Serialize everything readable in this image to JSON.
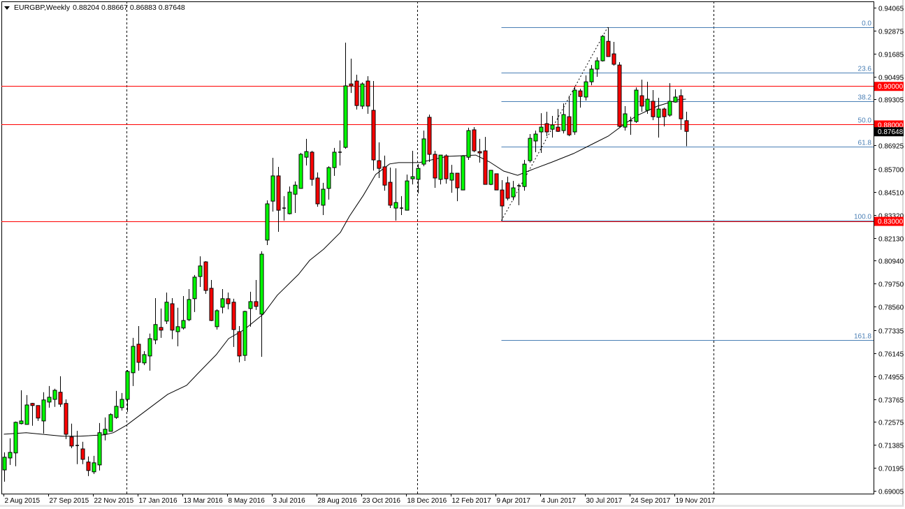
{
  "header": {
    "menu_icon": "triangle-down-icon",
    "symbol_timeframe": "EURGBP,Weekly",
    "ohlc": "0.88204 0.88667 0.86883 0.87648"
  },
  "colors": {
    "up": "#00ff00",
    "down": "#ff0000",
    "ma": "#000000",
    "fib": "#4a7fb5",
    "hline": "#ff0000",
    "current_price_bg": "#000000"
  },
  "chart_data": {
    "type": "candlestick",
    "title": "EURGBP,Weekly",
    "xlabel": "",
    "ylabel": "",
    "ylim": [
      0.6886,
      0.94463
    ],
    "grid": false,
    "y_tick_labels": [
      "0.94065",
      "0.92875",
      "0.91685",
      "0.90495",
      "0.89305",
      "0.86925",
      "0.85700",
      "0.84510",
      "0.83320",
      "0.82130",
      "0.80940",
      "0.79750",
      "0.78560",
      "0.77335",
      "0.76145",
      "0.74955",
      "0.73765",
      "0.72575",
      "0.71385",
      "0.70195",
      "0.69005"
    ],
    "x_tick_labels": [
      "2 Aug 2015",
      "27 Sep 2015",
      "22 Nov 2015",
      "17 Jan 2016",
      "13 Mar 2016",
      "8 May 2016",
      "3 Jul 2016",
      "28 Aug 2016",
      "23 Oct 2016",
      "18 Dec 2016",
      "12 Feb 2017",
      "9 Apr 2017",
      "4 Jun 2017",
      "30 Jul 2017",
      "24 Sep 2017",
      "19 Nov 2017"
    ],
    "x_tick_every_candles": 8,
    "period_separators_at_candle": [
      22,
      74,
      127
    ],
    "candles_ohlc": [
      [
        0.7009,
        0.71,
        0.6948,
        0.7075
      ],
      [
        0.7071,
        0.7173,
        0.7035,
        0.71
      ],
      [
        0.7097,
        0.726,
        0.7028,
        0.7256
      ],
      [
        0.7249,
        0.7422,
        0.7245,
        0.7263
      ],
      [
        0.7245,
        0.7397,
        0.7245,
        0.7346
      ],
      [
        0.7354,
        0.7357,
        0.7238,
        0.7343
      ],
      [
        0.7343,
        0.7343,
        0.7263,
        0.7278
      ],
      [
        0.7263,
        0.7412,
        0.7198,
        0.7372
      ],
      [
        0.7361,
        0.7444,
        0.7332,
        0.7386
      ],
      [
        0.7375,
        0.743,
        0.7336,
        0.7422
      ],
      [
        0.7412,
        0.7495,
        0.7336,
        0.735
      ],
      [
        0.7354,
        0.7375,
        0.7169,
        0.7194
      ],
      [
        0.718,
        0.7249,
        0.7122,
        0.7133
      ],
      [
        0.7136,
        0.7212,
        0.7039,
        0.7133
      ],
      [
        0.7118,
        0.7155,
        0.7039,
        0.7064
      ],
      [
        0.705,
        0.7079,
        0.6977,
        0.7006
      ],
      [
        0.6999,
        0.7082,
        0.6988,
        0.7046
      ],
      [
        0.7035,
        0.7252,
        0.7006,
        0.7202
      ],
      [
        0.7194,
        0.7281,
        0.7162,
        0.722
      ],
      [
        0.7209,
        0.7303,
        0.7209,
        0.7296
      ],
      [
        0.7281,
        0.7419,
        0.7274,
        0.7339
      ],
      [
        0.7332,
        0.7408,
        0.7317,
        0.7375
      ],
      [
        0.7375,
        0.7527,
        0.731,
        0.752
      ],
      [
        0.7513,
        0.7694,
        0.7444,
        0.765
      ],
      [
        0.7661,
        0.7755,
        0.7524,
        0.7567
      ],
      [
        0.7564,
        0.7625,
        0.7553,
        0.7607
      ],
      [
        0.76,
        0.7716,
        0.7524,
        0.769
      ],
      [
        0.7683,
        0.79,
        0.7661,
        0.7763
      ],
      [
        0.7748,
        0.7846,
        0.7694,
        0.7734
      ],
      [
        0.7781,
        0.7929,
        0.7766,
        0.7879
      ],
      [
        0.7871,
        0.79,
        0.7687,
        0.7734
      ],
      [
        0.7726,
        0.785,
        0.765,
        0.7752
      ],
      [
        0.7745,
        0.7911,
        0.7737,
        0.7784
      ],
      [
        0.7788,
        0.7947,
        0.7781,
        0.7893
      ],
      [
        0.7897,
        0.802,
        0.7828,
        0.8009
      ],
      [
        0.8012,
        0.8117,
        0.7958,
        0.8067
      ],
      [
        0.8088,
        0.8092,
        0.7922,
        0.794
      ],
      [
        0.7951,
        0.7994,
        0.7781,
        0.7784
      ],
      [
        0.7752,
        0.7842,
        0.7737,
        0.7835
      ],
      [
        0.7853,
        0.7947,
        0.7821,
        0.7897
      ],
      [
        0.7897,
        0.7929,
        0.7842,
        0.7871
      ],
      [
        0.7879,
        0.7897,
        0.7647,
        0.7737
      ],
      [
        0.7726,
        0.7755,
        0.7567,
        0.76
      ],
      [
        0.7603,
        0.7835,
        0.7574,
        0.7831
      ],
      [
        0.7846,
        0.7933,
        0.7752,
        0.7882
      ],
      [
        0.7882,
        0.7994,
        0.7839,
        0.7857
      ],
      [
        0.7817,
        0.8143,
        0.7596,
        0.8128
      ],
      [
        0.8201,
        0.8407,
        0.8175,
        0.8389
      ],
      [
        0.8403,
        0.8628,
        0.8349,
        0.8534
      ],
      [
        0.8534,
        0.8581,
        0.8244,
        0.8356
      ],
      [
        0.8367,
        0.8429,
        0.8302,
        0.8367
      ],
      [
        0.8338,
        0.8479,
        0.8334,
        0.845
      ],
      [
        0.8439,
        0.8505,
        0.8342,
        0.8486
      ],
      [
        0.8469,
        0.8653,
        0.8469,
        0.8646
      ],
      [
        0.8631,
        0.8726,
        0.8588,
        0.866
      ],
      [
        0.8657,
        0.8664,
        0.8483,
        0.8516
      ],
      [
        0.8523,
        0.8552,
        0.8374,
        0.8389
      ],
      [
        0.8382,
        0.8498,
        0.8331,
        0.8465
      ],
      [
        0.8469,
        0.8584,
        0.8411,
        0.8577
      ],
      [
        0.8577,
        0.8679,
        0.8534,
        0.8657
      ],
      [
        0.8657,
        0.8718,
        0.8588,
        0.8657
      ],
      [
        0.8682,
        0.9225,
        0.8675,
        0.9001
      ],
      [
        0.9011,
        0.9142,
        0.8964,
        0.9001
      ],
      [
        0.9026,
        0.9059,
        0.8878,
        0.8899
      ],
      [
        0.8896,
        0.9019,
        0.8881,
        0.9011
      ],
      [
        0.9026,
        0.9051,
        0.8856,
        0.8896
      ],
      [
        0.8874,
        0.9026,
        0.8562,
        0.8617
      ],
      [
        0.8613,
        0.8708,
        0.8523,
        0.8573
      ],
      [
        0.8581,
        0.8639,
        0.8457,
        0.8486
      ],
      [
        0.8501,
        0.8577,
        0.8367,
        0.8382
      ],
      [
        0.8367,
        0.8573,
        0.8302,
        0.8396
      ],
      [
        0.8367,
        0.8429,
        0.8331,
        0.8367
      ],
      [
        0.8356,
        0.8541,
        0.8356,
        0.8508
      ],
      [
        0.8519,
        0.8664,
        0.849,
        0.853
      ],
      [
        0.8516,
        0.8595,
        0.8443,
        0.8573
      ],
      [
        0.8595,
        0.8769,
        0.8584,
        0.8726
      ],
      [
        0.8838,
        0.8852,
        0.8606,
        0.8646
      ],
      [
        0.8646,
        0.8664,
        0.8472,
        0.8523
      ],
      [
        0.8516,
        0.8642,
        0.849,
        0.8642
      ],
      [
        0.8638,
        0.8646,
        0.8494,
        0.8519
      ],
      [
        0.8512,
        0.8591,
        0.8447,
        0.8548
      ],
      [
        0.8548,
        0.8548,
        0.8403,
        0.8472
      ],
      [
        0.8461,
        0.8642,
        0.8461,
        0.8638
      ],
      [
        0.8631,
        0.8784,
        0.8617,
        0.8769
      ],
      [
        0.8773,
        0.8787,
        0.8657,
        0.8664
      ],
      [
        0.866,
        0.8726,
        0.8603,
        0.8653
      ],
      [
        0.8664,
        0.8736,
        0.849,
        0.849
      ],
      [
        0.849,
        0.8563,
        0.8486,
        0.8563
      ],
      [
        0.8545,
        0.8545,
        0.8461,
        0.8461
      ],
      [
        0.8461,
        0.8512,
        0.8302,
        0.8378
      ],
      [
        0.8498,
        0.853,
        0.8407,
        0.8418
      ],
      [
        0.8425,
        0.8508,
        0.8407,
        0.8472
      ],
      [
        0.8483,
        0.8494,
        0.8382,
        0.8483
      ],
      [
        0.8479,
        0.8617,
        0.8457,
        0.8595
      ],
      [
        0.8613,
        0.8751,
        0.8603,
        0.8729
      ],
      [
        0.8715,
        0.8769,
        0.8657,
        0.8751
      ],
      [
        0.8762,
        0.8859,
        0.8653,
        0.8787
      ],
      [
        0.8805,
        0.8867,
        0.874,
        0.8762
      ],
      [
        0.8776,
        0.8845,
        0.8733,
        0.8798
      ],
      [
        0.8787,
        0.8881,
        0.8762,
        0.8765
      ],
      [
        0.8769,
        0.891,
        0.8754,
        0.8852
      ],
      [
        0.8841,
        0.895,
        0.874,
        0.8747
      ],
      [
        0.8762,
        0.8997,
        0.8747,
        0.8979
      ],
      [
        0.8975,
        0.8986,
        0.8888,
        0.8946
      ],
      [
        0.8943,
        0.9055,
        0.8925,
        0.9022
      ],
      [
        0.9022,
        0.9109,
        0.9004,
        0.9088
      ],
      [
        0.9088,
        0.9149,
        0.9048,
        0.9131
      ],
      [
        0.9131,
        0.9265,
        0.9127,
        0.9258
      ],
      [
        0.9232,
        0.9305,
        0.9153,
        0.9153
      ],
      [
        0.9167,
        0.9229,
        0.9106,
        0.9113
      ],
      [
        0.9109,
        0.9124,
        0.8787,
        0.8791
      ],
      [
        0.8787,
        0.8896,
        0.8769,
        0.8856
      ],
      [
        0.882,
        0.8841,
        0.8747,
        0.882
      ],
      [
        0.8816,
        0.8993,
        0.8809,
        0.8979
      ],
      [
        0.895,
        0.9033,
        0.8867,
        0.8896
      ],
      [
        0.8874,
        0.9022,
        0.8856,
        0.8932
      ],
      [
        0.8921,
        0.8979,
        0.8823,
        0.8841
      ],
      [
        0.8838,
        0.8939,
        0.8733,
        0.8881
      ],
      [
        0.8881,
        0.8888,
        0.8791,
        0.8841
      ],
      [
        0.8849,
        0.9015,
        0.8841,
        0.8921
      ],
      [
        0.8917,
        0.8983,
        0.8914,
        0.8943
      ],
      [
        0.895,
        0.8983,
        0.8773,
        0.883
      ],
      [
        0.88204,
        0.88667,
        0.86883,
        0.87648
      ]
    ],
    "moving_average": [
      [
        0,
        0.7194
      ],
      [
        4,
        0.7202
      ],
      [
        10.5,
        0.7184
      ],
      [
        13.6,
        0.7184
      ],
      [
        18,
        0.7191
      ],
      [
        19.6,
        0.7202
      ],
      [
        22,
        0.7242
      ],
      [
        25.5,
        0.7318
      ],
      [
        29.3,
        0.7401
      ],
      [
        32.7,
        0.7448
      ],
      [
        34.7,
        0.7509
      ],
      [
        38,
        0.7607
      ],
      [
        40.2,
        0.769
      ],
      [
        43,
        0.7737
      ],
      [
        46.4,
        0.7817
      ],
      [
        48.9,
        0.7915
      ],
      [
        52.7,
        0.8023
      ],
      [
        54.7,
        0.8096
      ],
      [
        57.2,
        0.8154
      ],
      [
        60.2,
        0.8241
      ],
      [
        61.8,
        0.8324
      ],
      [
        64.3,
        0.8433
      ],
      [
        66.5,
        0.8541
      ],
      [
        69,
        0.8596
      ],
      [
        70.6,
        0.8603
      ],
      [
        74.3,
        0.8603
      ],
      [
        79.3,
        0.8635
      ],
      [
        84.4,
        0.8642
      ],
      [
        86.9,
        0.8606
      ],
      [
        89.4,
        0.8559
      ],
      [
        91.9,
        0.8537
      ],
      [
        94.4,
        0.8566
      ],
      [
        98.1,
        0.8606
      ],
      [
        101.9,
        0.865
      ],
      [
        105.6,
        0.8704
      ],
      [
        108.1,
        0.874
      ],
      [
        110.6,
        0.8794
      ],
      [
        113.1,
        0.8845
      ],
      [
        116.9,
        0.8896
      ],
      [
        120.7,
        0.8929
      ],
      [
        122,
        0.8932
      ]
    ],
    "fibonacci": {
      "low": 0.8302,
      "low_candle": 89,
      "high": 0.9305,
      "high_candle": 108,
      "levels": [
        0.0,
        23.6,
        38.2,
        50.0,
        61.8,
        100.0,
        161.8
      ],
      "labels": [
        "0.0",
        "23.6",
        "38.2",
        "50.0",
        "61.8",
        "100.0",
        "161.8"
      ]
    },
    "horizontal_lines": [
      {
        "price": 0.9,
        "label": "0.90000"
      },
      {
        "price": 0.88,
        "label": "0.88000"
      },
      {
        "price": 0.83,
        "label": "0.83000"
      }
    ],
    "current_price": {
      "price": 0.87648,
      "label": "0.87648"
    }
  }
}
